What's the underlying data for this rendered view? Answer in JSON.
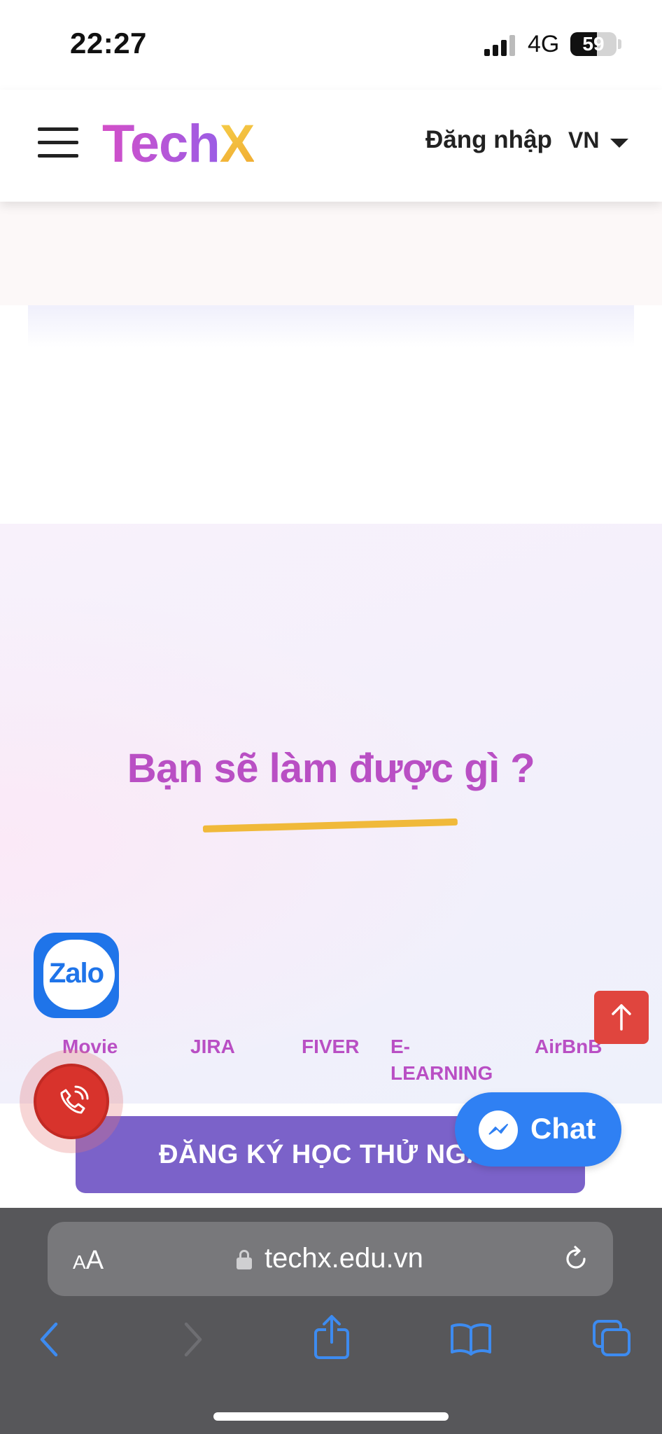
{
  "status_bar": {
    "time": "22:27",
    "network": "4G",
    "battery": "59"
  },
  "header": {
    "logo_part1": "Tech",
    "logo_part2": "X",
    "login_label": "Đăng nhập",
    "language": "VN"
  },
  "feature_section": {
    "title": "Bạn sẽ làm được gì ?",
    "tabs": [
      {
        "label": "Movie"
      },
      {
        "label": "JIRA"
      },
      {
        "label": "FIVER"
      },
      {
        "label": "E-\nLEARNING"
      },
      {
        "label": "AirBnB"
      }
    ]
  },
  "floating": {
    "zalo_label": "Zalo",
    "chat_label": "Chat"
  },
  "register_button": "ĐĂNG KÝ HỌC THỬ NGAY",
  "browser": {
    "text_size_label_small": "A",
    "text_size_label_big": "A",
    "url": "techx.edu.vn"
  },
  "colors": {
    "brand_purple": "#b94fc4",
    "accent_yellow": "#f0b93a",
    "register_purple": "#7b62c9",
    "chat_blue": "#2f80f3",
    "call_red": "#d8332c",
    "top_button_red": "#e0453e",
    "zalo_blue": "#1f74e9"
  }
}
